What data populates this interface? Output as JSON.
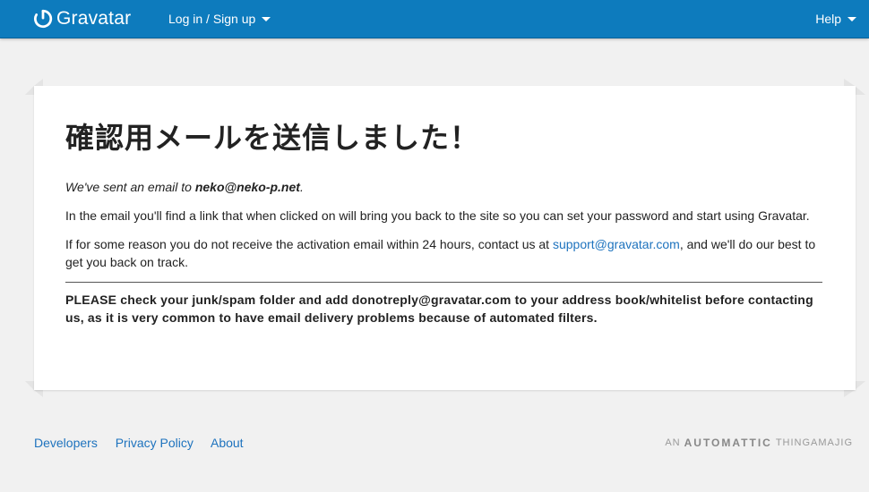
{
  "header": {
    "logo_text": "Gravatar",
    "login_label": "Log in / Sign up",
    "help_label": "Help"
  },
  "message": {
    "title": "確認用メールを送信しました！",
    "sent_prefix": "We've sent an email to ",
    "email": "neko@neko-p.net",
    "sent_suffix": ".",
    "instructions": "In the email you'll find a link that when clicked on will bring you back to the site so you can set your password and start using Gravatar.",
    "support_prefix": "If for some reason you do not receive the activation email within 24 hours, contact us at ",
    "support_email": "support@gravatar.com",
    "support_suffix": ", and we'll do our best to get you back on track.",
    "warning": "PLEASE check your junk/spam folder and add donotreply@gravatar.com to your address book/whitelist before contacting us, as it is very common to have email delivery problems because of automated filters."
  },
  "footer": {
    "links": [
      "Developers",
      "Privacy Policy",
      "About"
    ],
    "brand_prefix": "AN",
    "brand_name": "AUTOMATTIC",
    "brand_suffix": "THINGAMAJIG"
  },
  "colors": {
    "header_bg": "#0d7bbd",
    "link": "#1e73be",
    "page_bg": "#f1f1f1"
  }
}
